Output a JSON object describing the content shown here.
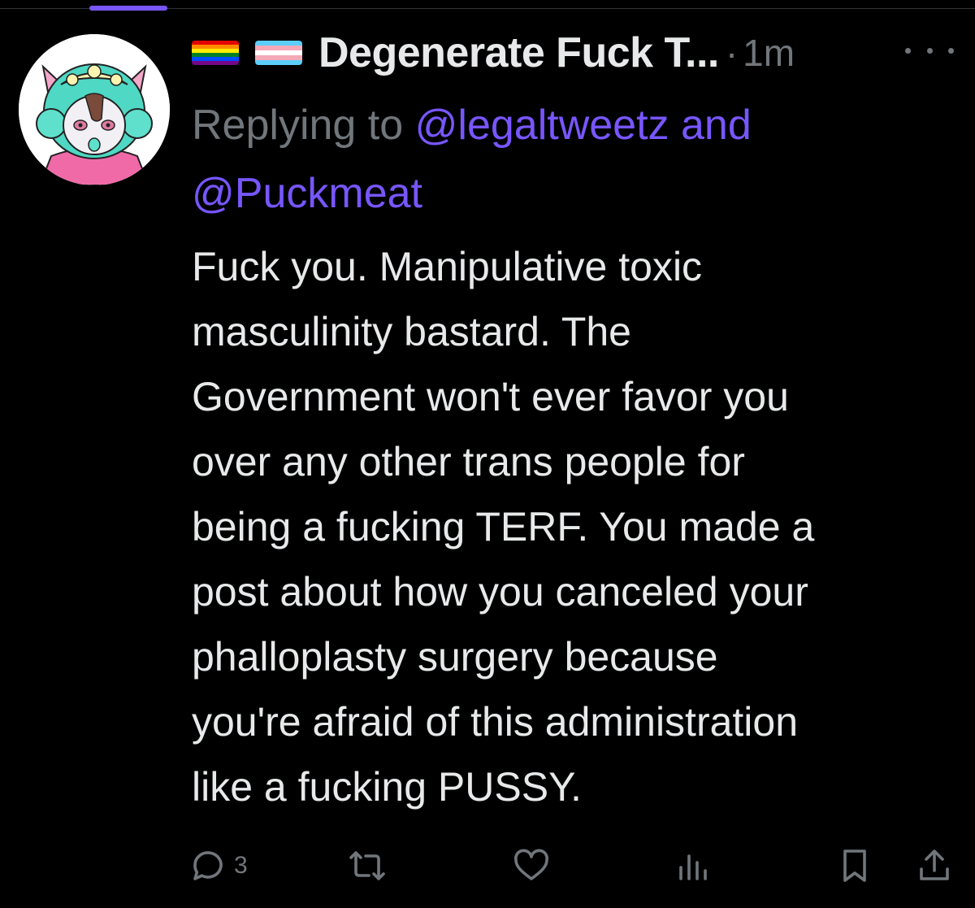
{
  "tweet": {
    "display_name": "Degenerate Fuck T...",
    "separator": "·",
    "timestamp": "1m",
    "replying_prefix": "Replying to",
    "reply_mention_1": "@legaltweetz",
    "reply_conjunction": "and",
    "reply_mention_2": "@Puckmeat",
    "text": "Fuck you. Manipulative toxic\nmasculinity bastard. The\nGovernment won't ever favor you\nover any other trans people for\nbeing a fucking TERF. You made a\npost about how you canceled your\nphalloplasty surgery because\nyou're afraid of this administration\nlike a fucking PUSSY.",
    "flags": [
      "rainbow-flag-icon",
      "transgender-flag-icon"
    ]
  },
  "actions": {
    "reply_count": "3",
    "icons": [
      "reply-icon",
      "retweet-icon",
      "like-icon",
      "views-icon",
      "bookmark-icon",
      "share-icon"
    ]
  },
  "colors": {
    "background": "#000000",
    "text": "#e7e9ea",
    "muted": "#71767b",
    "mention": "#7856ff",
    "tab_indicator": "#7856ff"
  }
}
